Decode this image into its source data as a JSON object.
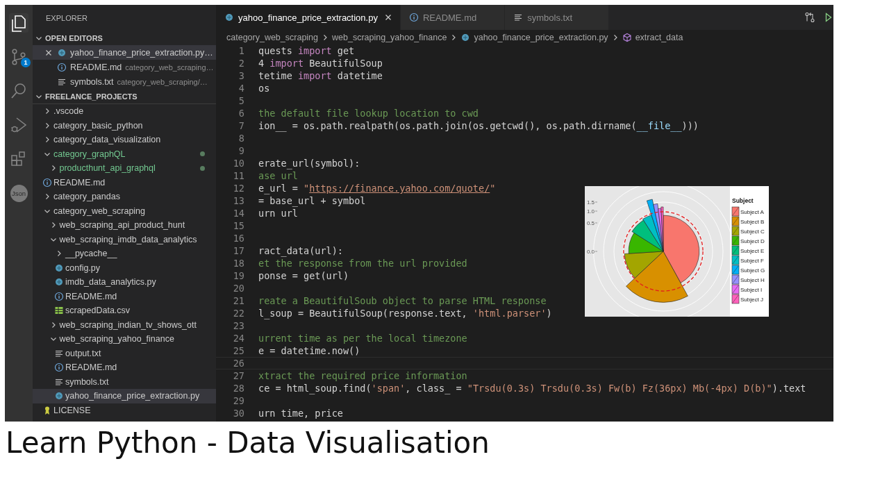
{
  "activity_bar": {
    "items": [
      {
        "kind": "files",
        "selected": true
      },
      {
        "kind": "source-control",
        "selected": false,
        "badge": "1"
      },
      {
        "kind": "search",
        "selected": false
      },
      {
        "kind": "run",
        "selected": false
      },
      {
        "kind": "extensions",
        "selected": false
      },
      {
        "kind": "avatar",
        "selected": false,
        "label": "Json"
      }
    ]
  },
  "sidebar": {
    "title": "EXPLORER",
    "open_editors": {
      "title": "OPEN EDITORS",
      "expanded": true,
      "items": [
        {
          "name": "yahoo_finance_price_extraction.py…",
          "kind": "python",
          "selected": true
        },
        {
          "name": "README.md",
          "kind": "info",
          "path": "category_web_scraping…",
          "selected": false
        },
        {
          "name": "symbols.txt",
          "kind": "text",
          "path": "category_web_scraping/…",
          "selected": false
        }
      ]
    },
    "project": {
      "title": "FREELANCE_PROJECTS",
      "expanded": true,
      "tree": [
        {
          "name": ".vscode",
          "kind": "folder",
          "expanded": false,
          "modified": false,
          "selected": false
        },
        {
          "name": "category_basic_python",
          "kind": "folder",
          "expanded": false,
          "modified": false,
          "selected": false
        },
        {
          "name": "category_data_visualization",
          "kind": "folder",
          "expanded": false,
          "modified": false,
          "selected": false
        },
        {
          "name": "category_graphQL",
          "kind": "folder",
          "expanded": true,
          "modified": true,
          "selected": false,
          "children": [
            {
              "name": "producthunt_api_graphql",
              "kind": "folder",
              "expanded": false,
              "modified": true,
              "selected": false
            }
          ]
        },
        {
          "name": "README.md",
          "kind": "info",
          "modified": false,
          "selected": false
        },
        {
          "name": "category_pandas",
          "kind": "folder",
          "expanded": false,
          "modified": false,
          "selected": false
        },
        {
          "name": "category_web_scraping",
          "kind": "folder",
          "expanded": true,
          "modified": false,
          "selected": false,
          "children": [
            {
              "name": "web_scraping_api_product_hunt",
              "kind": "folder",
              "expanded": false,
              "modified": false,
              "selected": false
            },
            {
              "name": "web_scraping_imdb_data_analytics",
              "kind": "folder",
              "expanded": true,
              "modified": false,
              "selected": false,
              "children": [
                {
                  "name": "__pycache__",
                  "kind": "folder",
                  "expanded": false,
                  "modified": false,
                  "selected": false
                },
                {
                  "name": "config.py",
                  "kind": "python",
                  "modified": false,
                  "selected": false
                },
                {
                  "name": "imdb_data_analytics.py",
                  "kind": "python",
                  "modified": false,
                  "selected": false
                },
                {
                  "name": "README.md",
                  "kind": "info",
                  "modified": false,
                  "selected": false
                },
                {
                  "name": "scrapedData.csv",
                  "kind": "csv",
                  "modified": false,
                  "selected": false
                }
              ]
            },
            {
              "name": "web_scraping_indian_tv_shows_ott",
              "kind": "folder",
              "expanded": false,
              "modified": false,
              "selected": false
            },
            {
              "name": "web_scraping_yahoo_finance",
              "kind": "folder",
              "expanded": true,
              "modified": false,
              "selected": false,
              "children": [
                {
                  "name": "output.txt",
                  "kind": "text",
                  "modified": false,
                  "selected": false
                },
                {
                  "name": "README.md",
                  "kind": "info",
                  "modified": false,
                  "selected": false
                },
                {
                  "name": "symbols.txt",
                  "kind": "text",
                  "modified": false,
                  "selected": false
                },
                {
                  "name": "yahoo_finance_price_extraction.py",
                  "kind": "python",
                  "modified": false,
                  "selected": true
                }
              ]
            }
          ]
        },
        {
          "name": "LICENSE",
          "kind": "license",
          "modified": false,
          "selected": false
        }
      ]
    }
  },
  "editor": {
    "tabs": [
      {
        "label": "yahoo_finance_price_extraction.py",
        "kind": "python",
        "selected": true
      },
      {
        "label": "README.md",
        "kind": "info",
        "selected": false
      },
      {
        "label": "symbols.txt",
        "kind": "text",
        "selected": false
      }
    ],
    "actions": [
      {
        "kind": "compare"
      },
      {
        "kind": "run"
      }
    ],
    "breadcrumb": [
      {
        "label": "category_web_scraping",
        "kind": "folder"
      },
      {
        "label": "web_scraping_yahoo_finance",
        "kind": "folder"
      },
      {
        "label": "yahoo_finance_price_extraction.py",
        "kind": "python"
      },
      {
        "label": "extract_data",
        "kind": "symbol"
      }
    ],
    "lines": [
      {
        "n": "1",
        "current": false,
        "tokens": [
          {
            "text": "quests ",
            "kind": "plain"
          },
          {
            "text": "import",
            "kind": "keyword"
          },
          {
            "text": " get",
            "kind": "plain"
          }
        ]
      },
      {
        "n": "2",
        "current": false,
        "tokens": [
          {
            "text": "4 ",
            "kind": "plain"
          },
          {
            "text": "import",
            "kind": "keyword"
          },
          {
            "text": " BeautifulSoup",
            "kind": "plain"
          }
        ]
      },
      {
        "n": "3",
        "current": false,
        "tokens": [
          {
            "text": "tetime ",
            "kind": "plain"
          },
          {
            "text": "import",
            "kind": "keyword"
          },
          {
            "text": " datetime",
            "kind": "plain"
          }
        ]
      },
      {
        "n": "4",
        "current": false,
        "tokens": [
          {
            "text": "os",
            "kind": "plain"
          }
        ]
      },
      {
        "n": "5",
        "current": false
      },
      {
        "n": "6",
        "current": false,
        "tokens": [
          {
            "text": "the default file lookup location to cwd",
            "kind": "comment"
          }
        ]
      },
      {
        "n": "7",
        "current": false,
        "tokens": [
          {
            "text": "ion__ = os.path.realpath(os.path.join(os.getcwd(), os.path.dirname(",
            "kind": "plain"
          },
          {
            "text": "__file__",
            "kind": "variable"
          },
          {
            "text": ")))",
            "kind": "plain"
          }
        ]
      },
      {
        "n": "8",
        "current": false
      },
      {
        "n": "9",
        "current": false
      },
      {
        "n": "10",
        "current": false,
        "tokens": [
          {
            "text": "erate_url(symbol):",
            "kind": "plain"
          }
        ]
      },
      {
        "n": "11",
        "current": false,
        "tokens": [
          {
            "text": "ase url",
            "kind": "comment"
          }
        ]
      },
      {
        "n": "12",
        "current": false,
        "tokens": [
          {
            "text": "e_url = ",
            "kind": "plain"
          },
          {
            "text": "\"",
            "kind": "string"
          },
          {
            "text": "https://finance.yahoo.com/quote/",
            "kind": "link"
          },
          {
            "text": "\"",
            "kind": "string"
          }
        ]
      },
      {
        "n": "13",
        "current": false,
        "tokens": [
          {
            "text": "= base_url + symbol",
            "kind": "plain"
          }
        ]
      },
      {
        "n": "14",
        "current": false,
        "tokens": [
          {
            "text": "urn url",
            "kind": "plain"
          }
        ]
      },
      {
        "n": "15",
        "current": false
      },
      {
        "n": "16",
        "current": false
      },
      {
        "n": "17",
        "current": false,
        "tokens": [
          {
            "text": "ract_data(url):",
            "kind": "plain"
          }
        ]
      },
      {
        "n": "18",
        "current": false,
        "tokens": [
          {
            "text": "et the response from the url provided",
            "kind": "comment"
          }
        ]
      },
      {
        "n": "19",
        "current": false,
        "tokens": [
          {
            "text": "ponse = get(url)",
            "kind": "plain"
          }
        ]
      },
      {
        "n": "20",
        "current": false
      },
      {
        "n": "21",
        "current": false,
        "tokens": [
          {
            "text": "reate a BeautifulSoub object to parse HTML response",
            "kind": "comment"
          }
        ]
      },
      {
        "n": "22",
        "current": false,
        "tokens": [
          {
            "text": "l_soup = BeautifulSoup(response.text, ",
            "kind": "plain"
          },
          {
            "text": "'html.parser'",
            "kind": "string"
          },
          {
            "text": ")",
            "kind": "plain"
          }
        ]
      },
      {
        "n": "23",
        "current": false
      },
      {
        "n": "24",
        "current": false,
        "tokens": [
          {
            "text": "urrent time as per the local timezone",
            "kind": "comment"
          }
        ]
      },
      {
        "n": "25",
        "current": false,
        "tokens": [
          {
            "text": "e = datetime.now()",
            "kind": "plain"
          }
        ]
      },
      {
        "n": "26",
        "current": true
      },
      {
        "n": "27",
        "current": false,
        "tokens": [
          {
            "text": "xtract the required price information",
            "kind": "comment"
          }
        ]
      },
      {
        "n": "28",
        "current": false,
        "tokens": [
          {
            "text": "ce = html_soup.find(",
            "kind": "plain"
          },
          {
            "text": "'span'",
            "kind": "string"
          },
          {
            "text": ", class_ = ",
            "kind": "plain"
          },
          {
            "text": "\"Trsdu(0.3s) Trsdu(0.3s) Fw(b) Fz(36px) Mb(-4px) D(b)\"",
            "kind": "string"
          },
          {
            "text": ").text",
            "kind": "plain"
          }
        ]
      },
      {
        "n": "29",
        "current": false
      },
      {
        "n": "30",
        "current": false,
        "tokens": [
          {
            "text": "urn time, price",
            "kind": "plain"
          }
        ]
      }
    ],
    "chart": {
      "legend": {
        "title": "Subject",
        "items": [
          {
            "label": "Subject A",
            "color": "#f8766d"
          },
          {
            "label": "Subject B",
            "color": "#d89000"
          },
          {
            "label": "Subject C",
            "color": "#a3a500"
          },
          {
            "label": "Subject D",
            "color": "#39b600"
          },
          {
            "label": "Subject E",
            "color": "#00bf7d"
          },
          {
            "label": "Subject F",
            "color": "#00bfc4"
          },
          {
            "label": "Subject G",
            "color": "#00b0f6"
          },
          {
            "label": "Subject H",
            "color": "#9590ff"
          },
          {
            "label": "Subject I",
            "color": "#e76bf3"
          },
          {
            "label": "Subject J",
            "color": "#ff62bc"
          }
        ]
      },
      "tick_labels": [
        "1.5",
        "1.0",
        "0.5",
        "0.0"
      ]
    }
  },
  "caption": "Learn Python - Data Visualisation"
}
